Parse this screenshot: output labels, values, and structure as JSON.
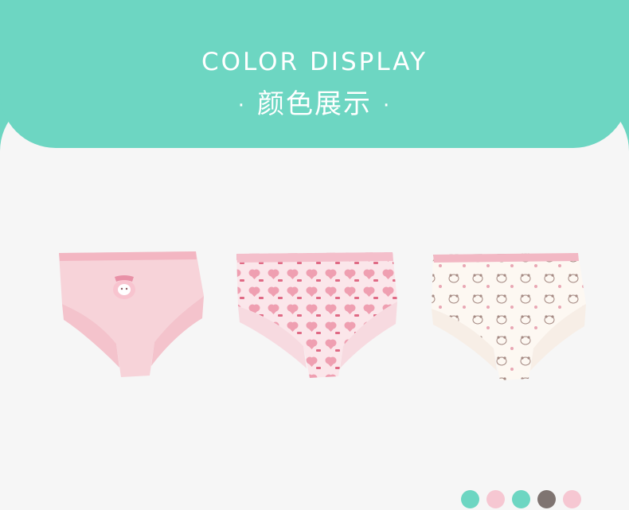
{
  "header": {
    "title_en": "COLOR DISPLAY",
    "title_cn": "颜色展示",
    "dot": "·"
  },
  "products": [
    {
      "variant": "solid-pink",
      "base": "#f7d3d9",
      "band": "#f3b6c2"
    },
    {
      "variant": "pink-hearts-print",
      "base": "#fbe6ea",
      "band": "#f4bfcb",
      "print": "#e9899d"
    },
    {
      "variant": "white-bear-print",
      "base": "#fdf8f2",
      "band": "#f2b8c4",
      "print": "#a58a83"
    }
  ],
  "swatches": [
    {
      "color": "#6dd6c2"
    },
    {
      "color": "#f6c7d2"
    },
    {
      "color": "#6dd6c2"
    },
    {
      "color": "#7f7471"
    },
    {
      "color": "#f6c7d2"
    }
  ]
}
